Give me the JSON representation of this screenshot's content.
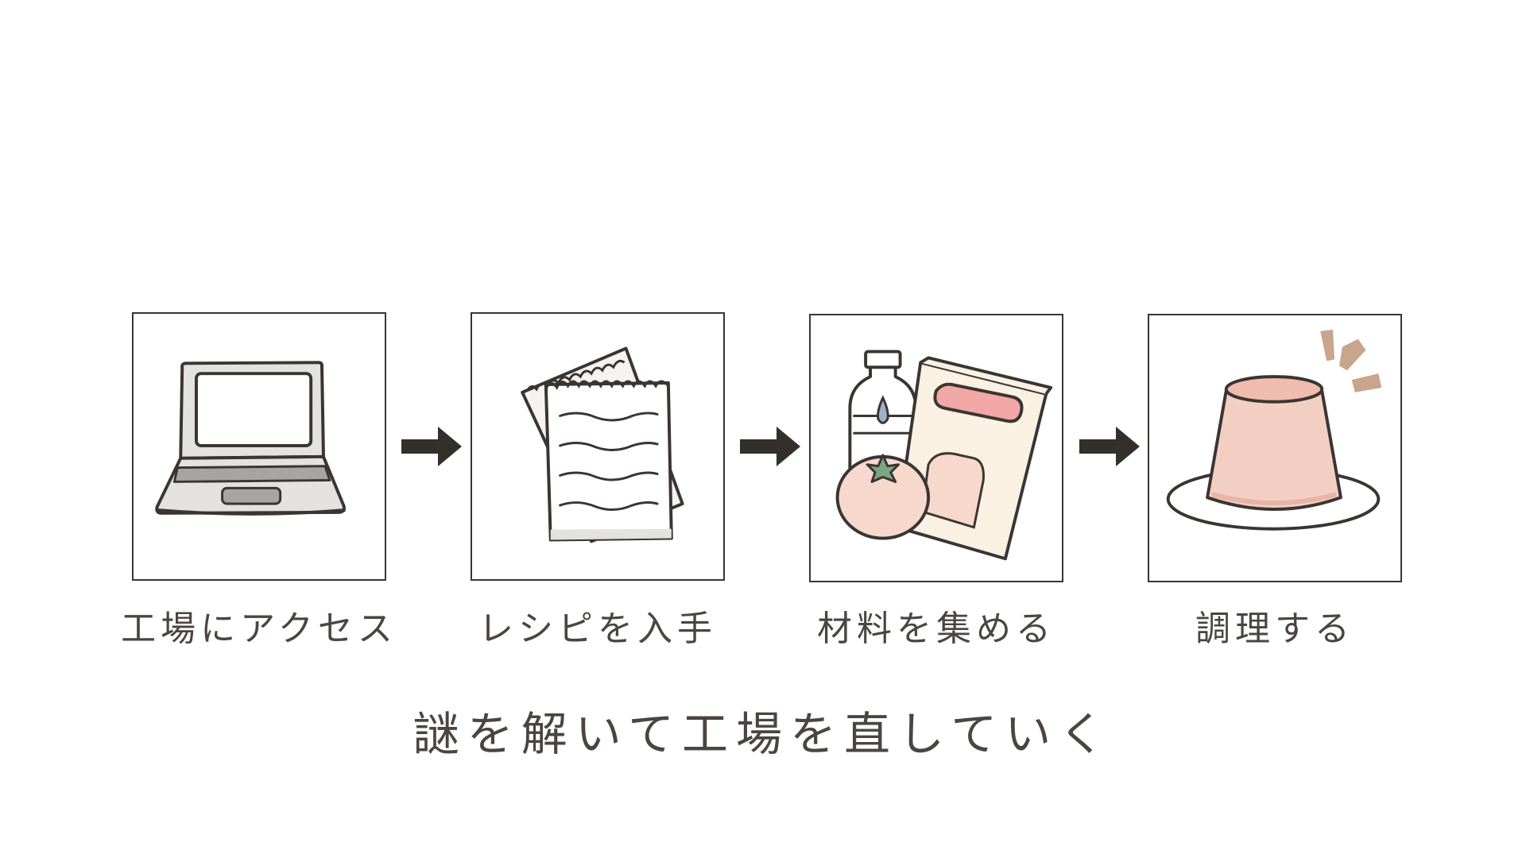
{
  "steps": [
    {
      "label": "工場にアクセス",
      "icon": "laptop-icon"
    },
    {
      "label": "レシピを入手",
      "icon": "recipe-notepad-icon"
    },
    {
      "label": "材料を集める",
      "icon": "ingredients-icon"
    },
    {
      "label": "調理する",
      "icon": "pudding-icon"
    }
  ],
  "caption": "謎を解いて工場を直していく",
  "colors": {
    "line": "#3a3532",
    "arrow": "#332f2b",
    "laptop_body": "#e4e2e0",
    "laptop_keys": "#a7a5a3",
    "paper": "#f4f3f1",
    "pink": "#f1a7a5",
    "peach": "#f6d8cc",
    "cream": "#faf1e2",
    "water_drop": "#9fb3c8",
    "leaf": "#7aa682",
    "pudding": "#f3cfc3",
    "accent_marks": "#c8a58c"
  }
}
